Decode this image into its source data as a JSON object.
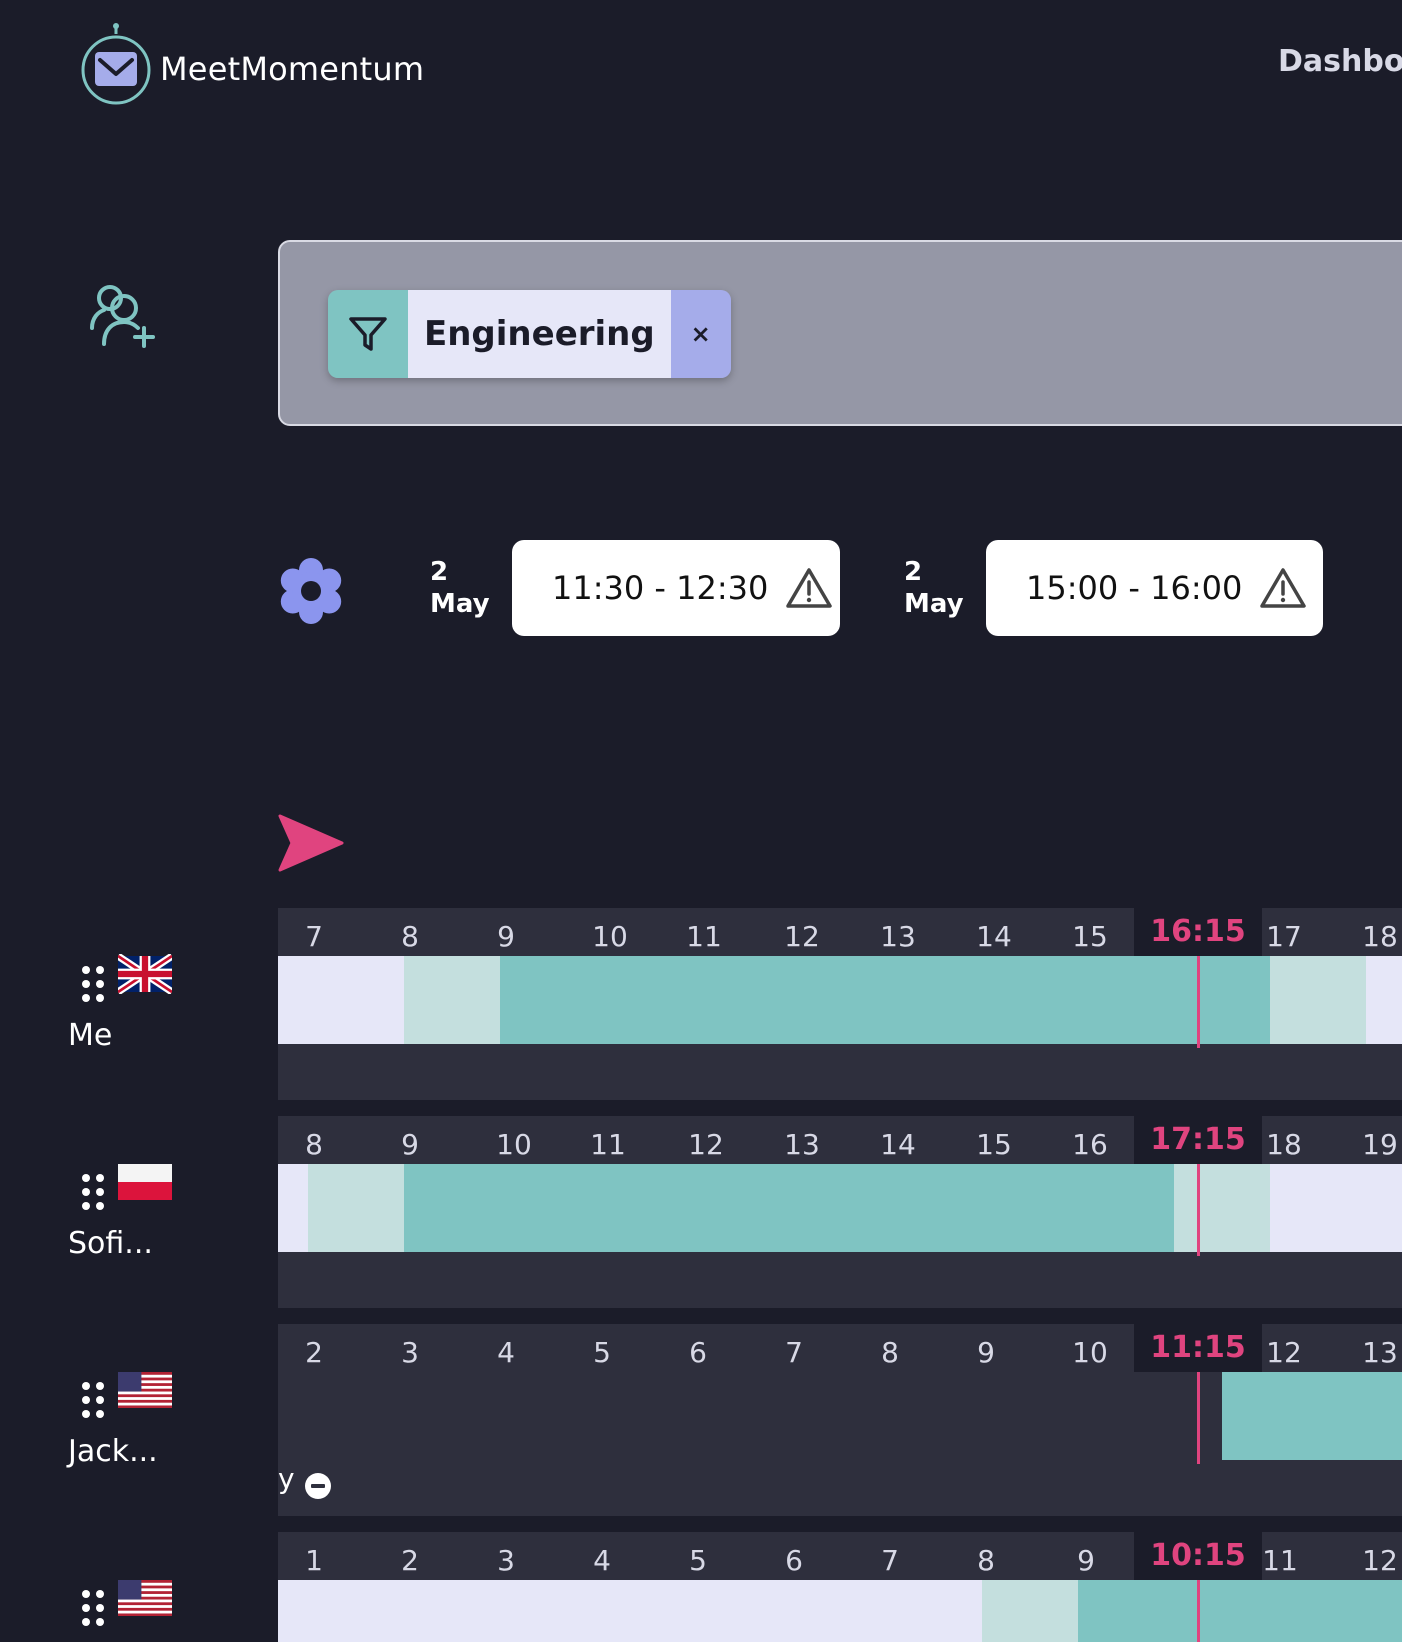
{
  "header": {
    "app_name": "MeetMomentum",
    "nav_dashboard": "Dashboa"
  },
  "filter": {
    "chip_label": "Engineering",
    "remove_symbol": "×"
  },
  "slots": [
    {
      "date_day": "2",
      "date_month": "May",
      "time": "11:30 - 12:30"
    },
    {
      "date_day": "2",
      "date_month": "May",
      "time": "15:00 - 16:00"
    }
  ],
  "colors": {
    "background": "#1b1c29",
    "accent_teal": "#7fc4c2",
    "light_teal": "#c4dfde",
    "lavender": "#e6e7f8",
    "chip_remove": "#a5acea",
    "now": "#e0447f",
    "gear": "#8b95ee"
  },
  "rows": [
    {
      "name": "Me",
      "flag": "uk",
      "hours": [
        "7",
        "8",
        "9",
        "10",
        "11",
        "12",
        "13",
        "14",
        "15",
        "17",
        "18"
      ],
      "now": "16:15",
      "below_text": ""
    },
    {
      "name": "Sofi...",
      "flag": "pl",
      "hours": [
        "8",
        "9",
        "10",
        "11",
        "12",
        "13",
        "14",
        "15",
        "16",
        "18",
        "19"
      ],
      "now": "17:15",
      "below_text": ""
    },
    {
      "name": "Jack...",
      "flag": "us",
      "hours": [
        "2",
        "3",
        "4",
        "5",
        "6",
        "7",
        "8",
        "9",
        "10",
        "12",
        "13"
      ],
      "now": "11:15",
      "below_text": "y"
    },
    {
      "name": "",
      "flag": "us",
      "hours": [
        "1",
        "2",
        "3",
        "4",
        "5",
        "6",
        "7",
        "8",
        "9",
        "11",
        "12"
      ],
      "now": "10:15",
      "below_text": ""
    }
  ]
}
